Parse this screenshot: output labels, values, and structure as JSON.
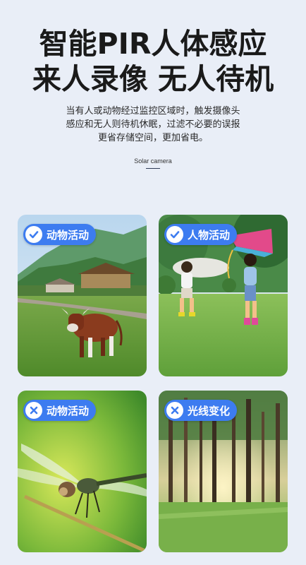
{
  "headline": {
    "line1": "智能PIR人体感应",
    "line2": "来人录像 无人待机"
  },
  "description": {
    "lines": [
      "当有人或动物经过监控区域时，触发摄像头",
      "感应和无人则待机休眠，过滤不必要的误报",
      "更省存储空间，更加省电。"
    ]
  },
  "tagline": "Solar camera",
  "cards": [
    {
      "label": "动物活动",
      "status": "check"
    },
    {
      "label": "人物活动",
      "status": "check"
    },
    {
      "label": "动物活动",
      "status": "cross"
    },
    {
      "label": "光线变化",
      "status": "cross"
    }
  ],
  "colors": {
    "accent": "#3d7cf0",
    "background": "#e9eef7"
  }
}
